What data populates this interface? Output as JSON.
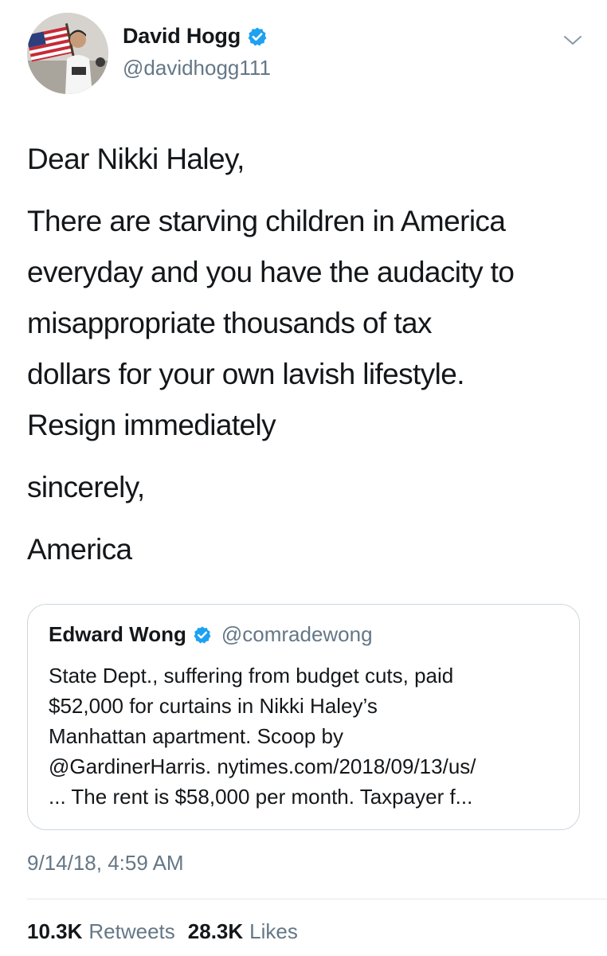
{
  "header": {
    "display_name": "David Hogg",
    "handle": "@davidhogg111",
    "verified": true
  },
  "tweet": {
    "lines": [
      "Dear Nikki Haley,",
      "There are starving children in America",
      "everyday and you have the audacity to",
      "misappropriate thousands of tax",
      "dollars for your own lavish lifestyle.",
      "Resign immediately",
      "sincerely,",
      "America"
    ]
  },
  "quote": {
    "display_name": "Edward Wong",
    "handle": "@comradewong",
    "verified": true,
    "lines": [
      "State Dept., suffering from budget cuts, paid",
      "$52,000 for curtains in Nikki Haley’s",
      "Manhattan apartment. Scoop by",
      "@GardinerHarris. nytimes.com/2018/09/13/us/",
      "... The rent is $58,000 per month. Taxpayer f..."
    ]
  },
  "timestamp": "9/14/18, 4:59 AM",
  "stats": {
    "retweets_count": "10.3K",
    "retweets_label": "Retweets",
    "likes_count": "28.3K",
    "likes_label": "Likes"
  },
  "colors": {
    "verified_blue": "#1da1f2",
    "secondary_text": "#657786",
    "border": "#ccd6dd"
  },
  "icons": {
    "verified": "verified-badge-icon",
    "caret": "chevron-down-icon"
  }
}
